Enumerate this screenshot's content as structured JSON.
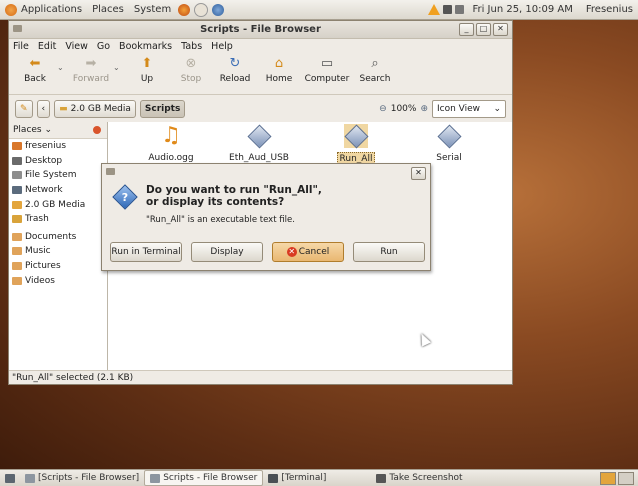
{
  "top_panel": {
    "menus": [
      "Applications",
      "Places",
      "System"
    ],
    "clock": "Fri Jun 25, 10:09 AM",
    "user": "Fresenius"
  },
  "window": {
    "title": "Scripts - File Browser",
    "menu": [
      "File",
      "Edit",
      "View",
      "Go",
      "Bookmarks",
      "Tabs",
      "Help"
    ],
    "toolbar": [
      {
        "label": "Back",
        "enabled": true
      },
      {
        "label": "Forward",
        "enabled": false
      },
      {
        "label": "Up",
        "enabled": true
      },
      {
        "label": "Stop",
        "enabled": false
      },
      {
        "label": "Reload",
        "enabled": true
      },
      {
        "label": "Home",
        "enabled": true
      },
      {
        "label": "Computer",
        "enabled": true
      },
      {
        "label": "Search",
        "enabled": true
      }
    ],
    "location": {
      "crumbs": [
        "2.0 GB Media",
        "Scripts"
      ],
      "zoom": "100%",
      "view": "Icon View"
    },
    "sidebar": {
      "header": "Places",
      "items": [
        {
          "label": "fresenius",
          "color": "#d9772b"
        },
        {
          "label": "Desktop",
          "color": "#6a6a6a"
        },
        {
          "label": "File System",
          "color": "#8e8e8e"
        },
        {
          "label": "Network",
          "color": "#5b6b7d"
        },
        {
          "label": "2.0 GB Media",
          "color": "#e3a53c"
        },
        {
          "label": "Trash",
          "color": "#d9a33a"
        },
        {
          "label": "Documents",
          "color": "#e0a35a"
        },
        {
          "label": "Music",
          "color": "#e0a35a"
        },
        {
          "label": "Pictures",
          "color": "#e0a35a"
        },
        {
          "label": "Videos",
          "color": "#e0a35a"
        }
      ]
    },
    "files": [
      "Audio.ogg",
      "Eth_Aud_USB",
      "Run_All",
      "Serial"
    ],
    "status": "\"Run_All\" selected (2.1 KB)"
  },
  "dialog": {
    "title": "Do you want to run \"Run_All\",\nor display its contents?",
    "subtitle": "\"Run_All\" is an executable text file.",
    "buttons": {
      "run_in_terminal": "Run in Terminal",
      "display": "Display",
      "cancel": "Cancel",
      "run": "Run"
    }
  },
  "bottom_panel": {
    "tasks": [
      "[Scripts - File Browser]",
      "Scripts - File Browser",
      "[Terminal]",
      "Take Screenshot"
    ]
  }
}
